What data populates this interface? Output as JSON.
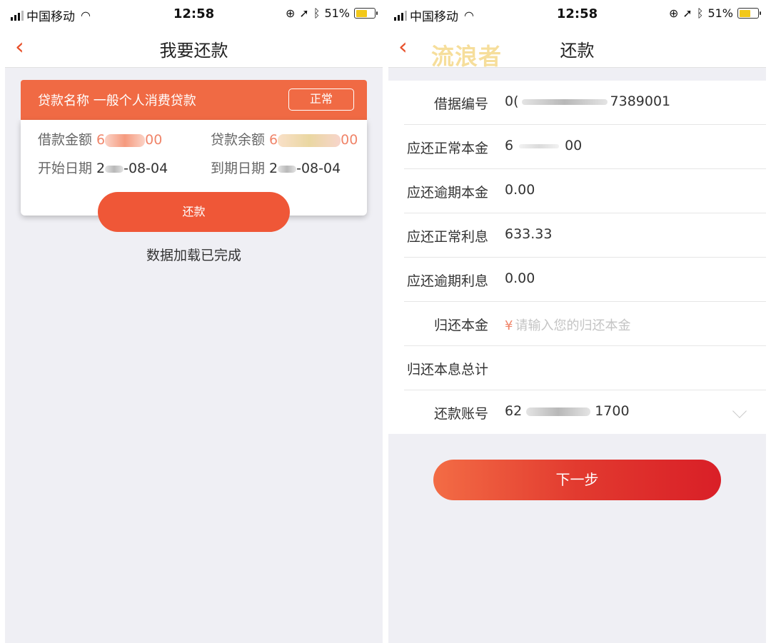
{
  "status_bar": {
    "carrier": "中国移动",
    "time": "12:58",
    "battery": "51%"
  },
  "left": {
    "nav": {
      "title": "我要还款"
    },
    "loan": {
      "header": "贷款名称 一般个人消费贷款",
      "status": "正常",
      "amount_label": "借款金额",
      "amount_prefix": "6",
      "amount_suffix": "00",
      "balance_label": "贷款余额",
      "balance_prefix": "6",
      "balance_suffix": "00",
      "start_label": "开始日期",
      "start_prefix": "2",
      "start_suffix": "-08-04",
      "end_label": "到期日期",
      "end_prefix": "2",
      "end_suffix": "-08-04"
    },
    "repay_button": "还款",
    "loaded_text": "数据加载已完成"
  },
  "right": {
    "nav": {
      "title": "还款"
    },
    "watermark": "流浪者",
    "rows": [
      {
        "label": "借据编号",
        "value_prefix": "0(",
        "value_suffix": "7389001"
      },
      {
        "label": "应还正常本金",
        "value_prefix": "6",
        "value_suffix": "00"
      },
      {
        "label": "应还逾期本金",
        "value": "0.00"
      },
      {
        "label": "应还正常利息",
        "value": "633.33"
      },
      {
        "label": "应还逾期利息",
        "value": "0.00"
      },
      {
        "label": "归还本金",
        "currency": "¥",
        "placeholder": "请输入您的归还本金"
      },
      {
        "label": "归还本息总计",
        "value": ""
      },
      {
        "label": "还款账号",
        "value_prefix": "62",
        "value_suffix": "1700"
      }
    ],
    "next_button": "下一步"
  }
}
